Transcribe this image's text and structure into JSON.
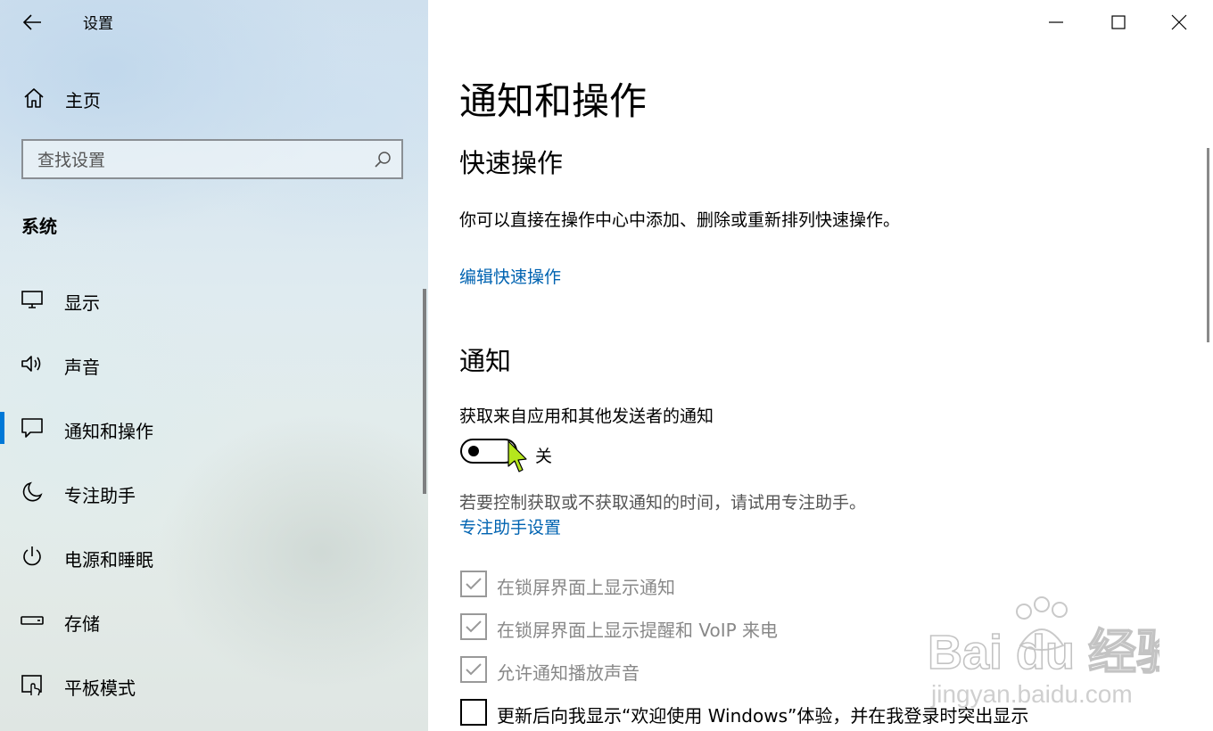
{
  "window": {
    "app_title": "设置",
    "controls": {
      "minimize": "minimize-icon",
      "maximize": "maximize-icon",
      "close": "close-icon"
    }
  },
  "sidebar": {
    "home_label": "主页",
    "search_placeholder": "查找设置",
    "section": "系统",
    "items": [
      {
        "label": "显示",
        "icon": "display-icon"
      },
      {
        "label": "声音",
        "icon": "speaker-icon"
      },
      {
        "label": "通知和操作",
        "icon": "notification-icon",
        "active": true
      },
      {
        "label": "专注助手",
        "icon": "moon-icon"
      },
      {
        "label": "电源和睡眠",
        "icon": "power-icon"
      },
      {
        "label": "存储",
        "icon": "storage-icon"
      },
      {
        "label": "平板模式",
        "icon": "tablet-icon"
      }
    ]
  },
  "main": {
    "title": "通知和操作",
    "quick_actions": {
      "heading": "快速操作",
      "description": "你可以直接在操作中心中添加、删除或重新排列快速操作。",
      "edit_link": "编辑快速操作"
    },
    "notifications": {
      "heading": "通知",
      "toggle_label": "获取来自应用和其他发送者的通知",
      "toggle_state": "关",
      "toggle_on": false,
      "focus_hint": "若要控制获取或不获取通知的时间，请试用专注助手。",
      "focus_link": "专注助手设置",
      "checkboxes": [
        {
          "label": "在锁屏界面上显示通知",
          "checked": true,
          "disabled": true
        },
        {
          "label": "在锁屏界面上显示提醒和 VoIP 来电",
          "checked": true,
          "disabled": true
        },
        {
          "label": "允许通知播放声音",
          "checked": true,
          "disabled": true
        },
        {
          "label": "更新后向我显示“欢迎使用 Windows”体验，并在我登录时突出显示",
          "checked": false,
          "disabled": false
        }
      ]
    }
  },
  "watermark": {
    "brand": "Bai du 经验",
    "url": "jingyan.baidu.com"
  },
  "colors": {
    "accent": "#0078d7",
    "link": "#0063b1"
  }
}
